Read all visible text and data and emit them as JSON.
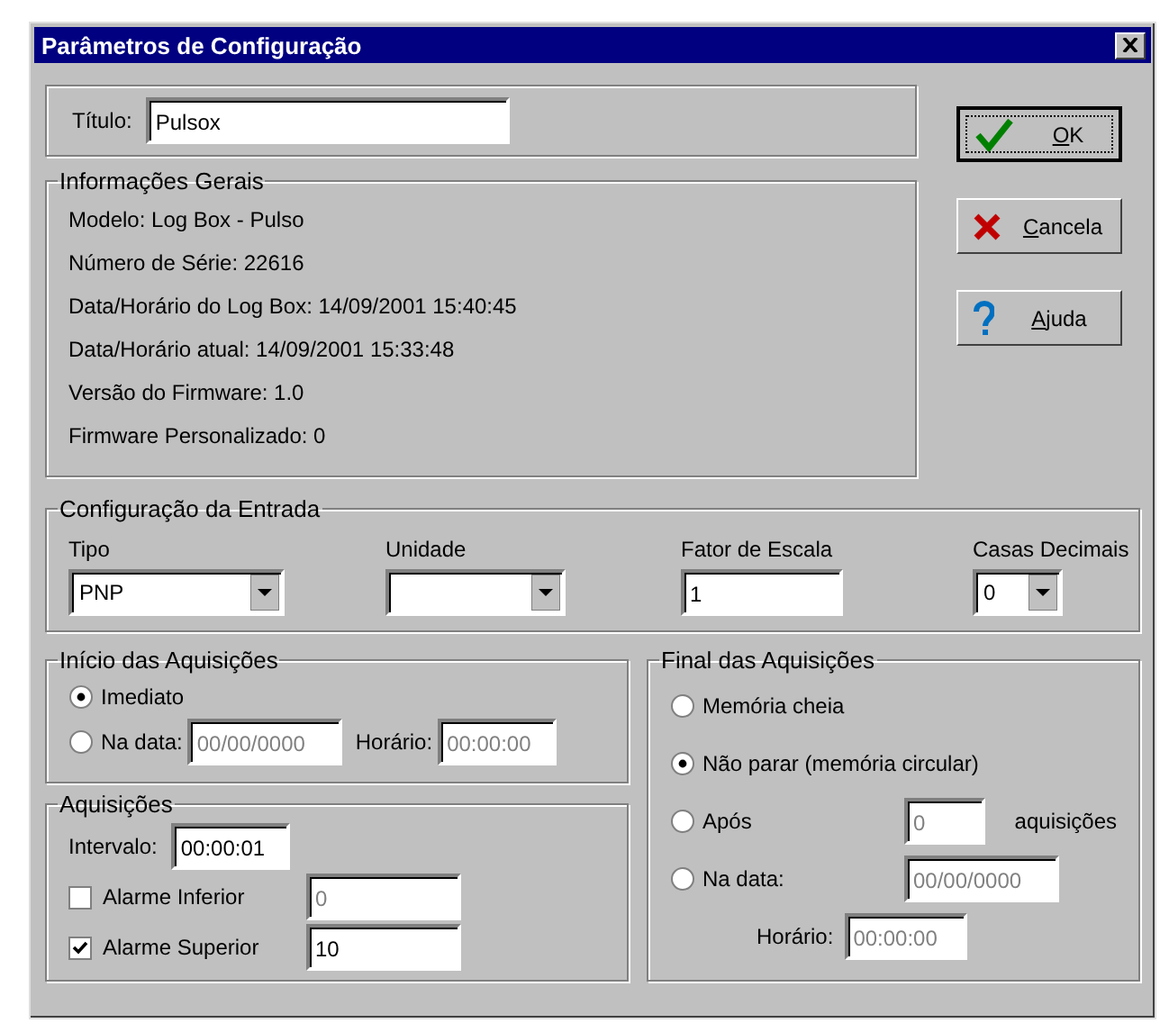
{
  "window": {
    "title": "Parâmetros de Configuração"
  },
  "title_field": {
    "label": "Título:",
    "value": "Pulsox"
  },
  "general_info": {
    "legend": "Informações Gerais",
    "lines": [
      "Modelo: Log Box - Pulso",
      "Número de Série: 22616",
      "Data/Horário do Log Box: 14/09/2001 15:40:45",
      "Data/Horário atual: 14/09/2001 15:33:48",
      "Versão do Firmware: 1.0",
      "Firmware Personalizado: 0"
    ]
  },
  "buttons": [
    {
      "kind": "ok",
      "label": "OK",
      "focused": true
    },
    {
      "kind": "cancel",
      "label": "Cancela",
      "focused": false
    },
    {
      "kind": "help",
      "label": "Ajuda",
      "focused": false
    }
  ],
  "input_config": {
    "legend": "Configuração da Entrada",
    "fields": [
      {
        "kind": "combo",
        "label": "Tipo",
        "value": "PNP"
      },
      {
        "kind": "combo",
        "label": "Unidade"
      },
      {
        "kind": "text",
        "label": "Fator de Escala",
        "value": "1"
      },
      {
        "kind": "combo",
        "label": "Casas Decimais",
        "value": "0"
      }
    ]
  },
  "start": {
    "legend": "Início das Aquisições",
    "options": [
      {
        "kind": "plain",
        "label": "Imediato",
        "selected": true
      },
      {
        "kind": "date",
        "label": "Na data:",
        "selected": false,
        "value": "00/00/0000",
        "time_label": "Horário:",
        "time": "00:00:00"
      }
    ]
  },
  "acquisitions": {
    "legend": "Aquisições",
    "interval_label": "Intervalo:",
    "interval": "00:00:01",
    "alarms": [
      {
        "label": "Alarme Inferior",
        "checked": false,
        "value": "0"
      },
      {
        "label": "Alarme Superior",
        "checked": true,
        "value": "10"
      }
    ]
  },
  "end": {
    "legend": "Final das Aquisições",
    "options": [
      {
        "kind": "plain",
        "label": "Memória cheia",
        "selected": false
      },
      {
        "kind": "plain",
        "label": "Não parar (memória circular)",
        "selected": true
      },
      {
        "kind": "count",
        "label": "Após",
        "selected": false,
        "value": "0",
        "suffix": "aquisições"
      },
      {
        "kind": "date",
        "label": "Na data:",
        "selected": false,
        "value": "00/00/0000",
        "time_label": "Horário:",
        "time": "00:00:00"
      }
    ]
  }
}
